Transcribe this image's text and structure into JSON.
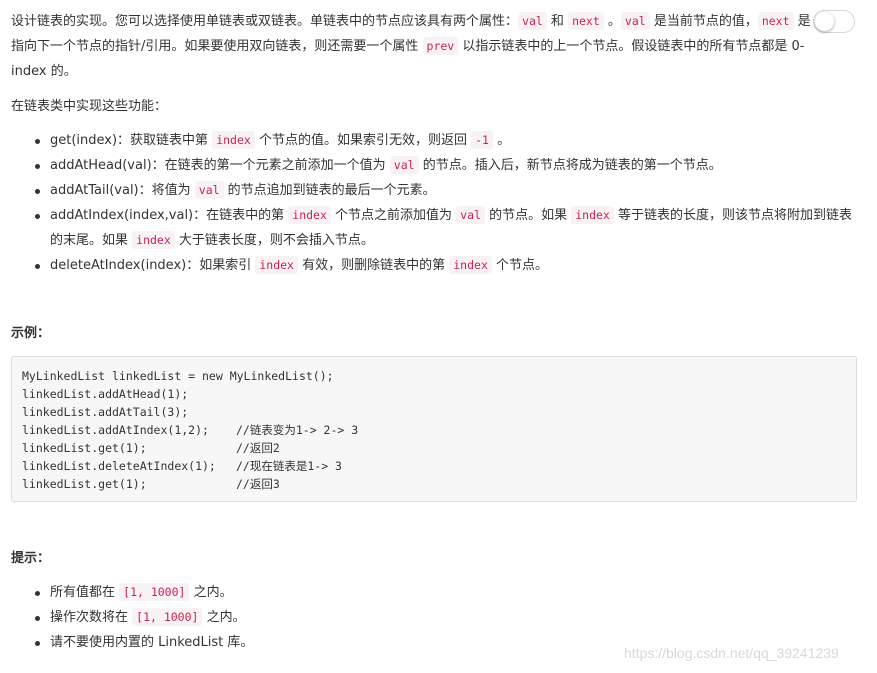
{
  "intro": {
    "t1": "设计链表的实现。您可以选择使用单链表或双链表。单链表中的节点应该具有两个属性：",
    "c_val": "val",
    "t2": " 和 ",
    "c_next": "next",
    "t3": " 。",
    "c_val2": "val",
    "t4": " 是当前节点的值，",
    "c_next2": "next",
    "t5": " 是指向下一个节点的指针/引用。如果要使用双向链表，则还需要一个属性 ",
    "c_prev": "prev",
    "t6": " 以指示链表中的上一个节点。假设链表中的所有节点都是 0-index 的。"
  },
  "toggle": {
    "state": "off"
  },
  "implement_heading": "在链表类中实现这些功能：",
  "functions": [
    {
      "a": "get(index)：获取链表中第 ",
      "c1": "index",
      "b": " 个节点的值。如果索引无效，则返回 ",
      "c2": "-1",
      "c": " 。"
    },
    {
      "a": "addAtHead(val)：在链表的第一个元素之前添加一个值为 ",
      "c1": "val",
      "b": " 的节点。插入后，新节点将成为链表的第一个节点。"
    },
    {
      "a": "addAtTail(val)：将值为 ",
      "c1": "val",
      "b": " 的节点追加到链表的最后一个元素。"
    },
    {
      "a": "addAtIndex(index,val)：在链表中的第 ",
      "c1": "index",
      "b": " 个节点之前添加值为 ",
      "c2": "val",
      "c": " 的节点。如果 ",
      "c3": "index",
      "d": " 等于链表的长度，则该节点将附加到链表的末尾。如果 ",
      "c4": "index",
      "e": " 大于链表长度，则不会插入节点。"
    },
    {
      "a": "deleteAtIndex(index)：如果索引 ",
      "c1": "index",
      "b": " 有效，则删除链表中的第 ",
      "c2": "index",
      "c": " 个节点。"
    }
  ],
  "example_heading": "示例：",
  "example_code": [
    {
      "code": "MyLinkedList linkedList = new MyLinkedList();",
      "comment": ""
    },
    {
      "code": "linkedList.addAtHead(1);",
      "comment": ""
    },
    {
      "code": "linkedList.addAtTail(3);",
      "comment": ""
    },
    {
      "code": "linkedList.addAtIndex(1,2);",
      "comment": "//链表变为1-> 2-> 3"
    },
    {
      "code": "linkedList.get(1);",
      "comment": "//返回2"
    },
    {
      "code": "linkedList.deleteAtIndex(1);",
      "comment": "//现在链表是1-> 3"
    },
    {
      "code": "linkedList.get(1);",
      "comment": "//返回3"
    }
  ],
  "hints_heading": "提示：",
  "hints": [
    {
      "a": "所有值都在 ",
      "c1": "[1, 1000]",
      "b": " 之内。"
    },
    {
      "a": "操作次数将在  ",
      "c1": "[1, 1000]",
      "b": " 之内。"
    },
    {
      "a": "请不要使用内置的 LinkedList 库。"
    }
  ],
  "watermark": "https://blog.csdn.net/qq_39241239"
}
